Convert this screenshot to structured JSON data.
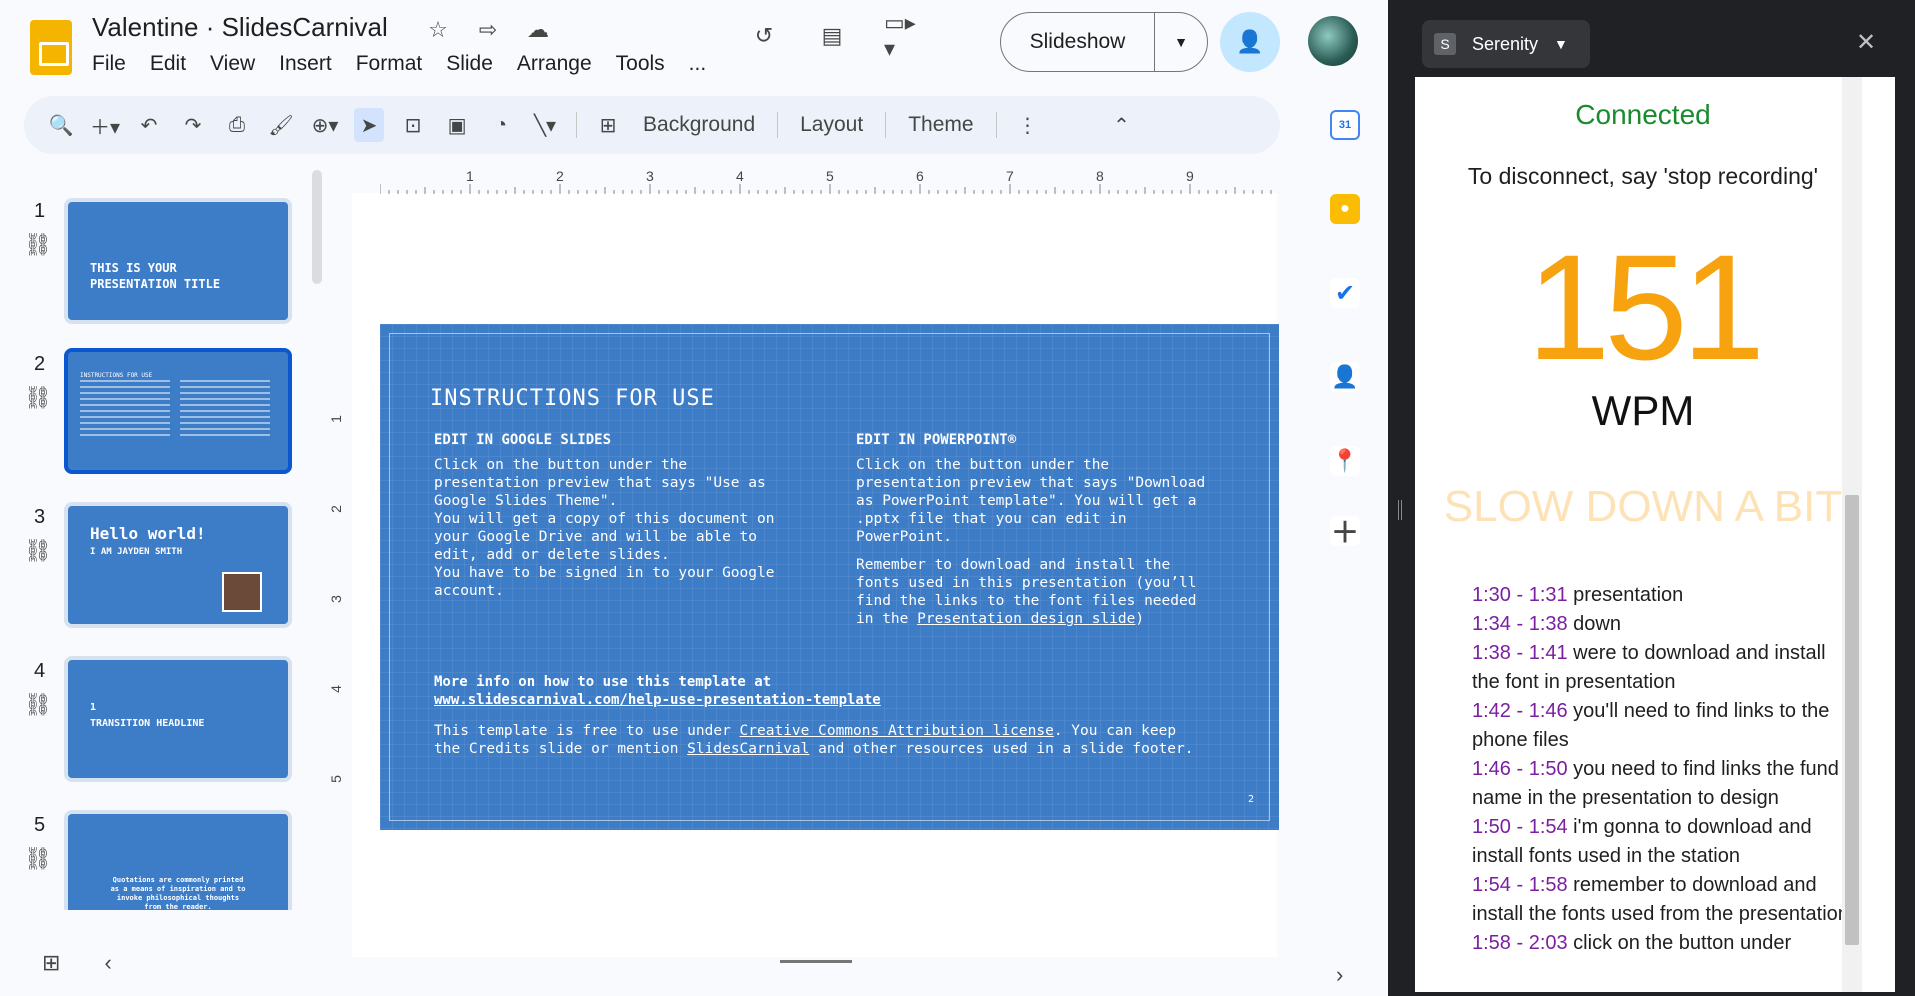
{
  "doc": {
    "title": "Valentine · SlidesCarnival",
    "menu": [
      "File",
      "Edit",
      "View",
      "Insert",
      "Format",
      "Slide",
      "Arrange",
      "Tools",
      "..."
    ],
    "slideshow_label": "Slideshow"
  },
  "toolbar": {
    "background_label": "Background",
    "layout_label": "Layout",
    "theme_label": "Theme"
  },
  "ruler": {
    "h_ticks": [
      "1",
      "2",
      "3",
      "4",
      "5",
      "6",
      "7",
      "8",
      "9"
    ],
    "v_ticks": [
      "1",
      "2",
      "3",
      "4",
      "5"
    ]
  },
  "thumbnails": [
    {
      "num": "1",
      "title": "THIS IS YOUR\nPRESENTATION TITLE"
    },
    {
      "num": "2",
      "title": "INSTRUCTIONS FOR USE"
    },
    {
      "num": "3",
      "title": "Hello world!",
      "subtitle": "I AM JAYDEN SMITH"
    },
    {
      "num": "4",
      "title": "1\nTRANSITION HEADLINE"
    },
    {
      "num": "5",
      "title": "Quotations are commonly printed\nas a means of inspiration and to\ninvoke philosophical thoughts\nfrom the reader."
    }
  ],
  "slide": {
    "title": "INSTRUCTIONS FOR USE",
    "col1_heading": "EDIT IN GOOGLE SLIDES",
    "col1_body": "Click on the button under the\npresentation preview that says \"Use as\nGoogle Slides Theme\".\nYou will get a copy of this document on\nyour Google Drive and will be able to\nedit, add or delete slides.\nYou have to be signed in to your Google\naccount.",
    "col2_heading": "EDIT IN POWERPOINT®",
    "col2_body": "Click on the button under the\npresentation preview that says \"Download\nas PowerPoint template\". You will get a\n.pptx file that you can edit in\nPowerPoint.",
    "col2_body2": "Remember to download and install the\nfonts used in this presentation (you’ll\nfind the links to the font files needed\nin the ",
    "col2_link": "Presentation design slide",
    "col2_tail": ")",
    "more_info": "More info on how to use this template at",
    "more_link": "www.slidescarnival.com/help-use-presentation-template",
    "free_1": "This template is free to use under ",
    "free_link": "Creative Commons Attribution license",
    "free_2": ". You can keep",
    "free_3": "the Credits slide or mention ",
    "free_link2": "SlidesCarnival",
    "free_4": " and other resources used in a slide footer.",
    "page_num": "2"
  },
  "extension": {
    "tab_letter": "S",
    "tab_name": "Serenity",
    "status": "Connected",
    "instruction": "To disconnect, say 'stop recording'",
    "wpm_value": "151",
    "wpm_label": "WPM",
    "warning": "SLOW DOWN A BIT",
    "transcript": [
      {
        "time": "1:30 - 1:31",
        "text": " presentation"
      },
      {
        "time": "1:34 - 1:38",
        "text": " down"
      },
      {
        "time": "1:38 - 1:41",
        "text": " were to download and install the font in presentation"
      },
      {
        "time": "1:42 - 1:46",
        "text": " you'll need to find links to the phone files"
      },
      {
        "time": "1:46 - 1:50",
        "text": " you need to find links the fund name in the presentation to design"
      },
      {
        "time": "1:50 - 1:54",
        "text": " i'm gonna to download and install fonts used in the station"
      },
      {
        "time": "1:54 - 1:58",
        "text": " remember to download and install the fonts used from the presentation"
      },
      {
        "time": "1:58 - 2:03",
        "text": " click on the button under"
      }
    ]
  },
  "colors": {
    "slide_blue": "#3d7cc7",
    "wpm_orange": "#f7a20f",
    "connected_green": "#198a2e",
    "time_purple": "#7b1fa2"
  }
}
